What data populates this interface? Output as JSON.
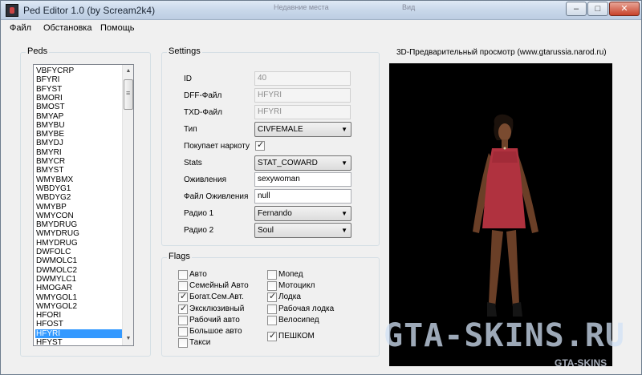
{
  "window": {
    "title": "Ped Editor 1.0 (by Scream2k4)",
    "background_text": [
      "Недавние места",
      "Вид"
    ],
    "controls": {
      "minimize": "–",
      "maximize": "□",
      "close": "✕"
    }
  },
  "menu": [
    "Файл",
    "Обстановка",
    "Помощь"
  ],
  "peds": {
    "title": "Peds",
    "items": [
      "VBFYCRP",
      "BFYRI",
      "BFYST",
      "BMORI",
      "BMOST",
      "BMYAP",
      "BMYBU",
      "BMYBE",
      "BMYDJ",
      "BMYRI",
      "BMYCR",
      "BMYST",
      "WMYBMX",
      "WBDYG1",
      "WBDYG2",
      "WMYBP",
      "WMYCON",
      "BMYDRUG",
      "WMYDRUG",
      "HMYDRUG",
      "DWFOLC",
      "DWMOLC1",
      "DWMOLC2",
      "DWMYLC1",
      "HMOGAR",
      "WMYGOL1",
      "WMYGOL2",
      "HFORI",
      "HFOST",
      "HFYRI",
      "HFYST"
    ],
    "selected": "HFYRI",
    "scroll_up": "▲",
    "scroll_down": "▼"
  },
  "settings": {
    "title": "Settings",
    "id_label": "ID",
    "id_value": "40",
    "dff_label": "DFF-Файл",
    "dff_value": "HFYRI",
    "txd_label": "TXD-Файл",
    "txd_value": "HFYRI",
    "type_label": "Тип",
    "type_value": "CIVFEMALE",
    "drugs_label": "Покупает наркоту",
    "drugs_checked": true,
    "stats_label": "Stats",
    "stats_value": "STAT_COWARD",
    "anim_label": "Оживления",
    "anim_value": "sexywoman",
    "anim_file_label": "Файл Оживления",
    "anim_file_value": "null",
    "radio1_label": "Радио 1",
    "radio1_value": "Fernando",
    "radio2_label": "Радио 2",
    "radio2_value": "Soul",
    "dropdown_arrow": "▼"
  },
  "flags": {
    "title": "Flags",
    "left": [
      {
        "label": "Авто",
        "checked": false
      },
      {
        "label": "Семейный Авто",
        "checked": false
      },
      {
        "label": "Богат.Сем.Авт.",
        "checked": true
      },
      {
        "label": "Эксклюзивный",
        "checked": true
      },
      {
        "label": "Рабочий авто",
        "checked": false
      },
      {
        "label": "Большое авто",
        "checked": false
      },
      {
        "label": "Такси",
        "checked": false
      }
    ],
    "right": [
      {
        "label": "Мопед",
        "checked": false
      },
      {
        "label": "Мотоцикл",
        "checked": false
      },
      {
        "label": "Лодка",
        "checked": true
      },
      {
        "label": "Рабочая лодка",
        "checked": false
      },
      {
        "label": "Велосипед",
        "checked": false
      },
      {
        "label": "ПЕШКОМ",
        "checked": true
      }
    ]
  },
  "preview": {
    "title": "3D-Предварительный просмотр (www.gtarussia.narod.ru)",
    "dress_color": "#b0323f"
  },
  "watermark": {
    "main": "GTA-SKINS.RU",
    "small": "GTA-SKINS"
  }
}
